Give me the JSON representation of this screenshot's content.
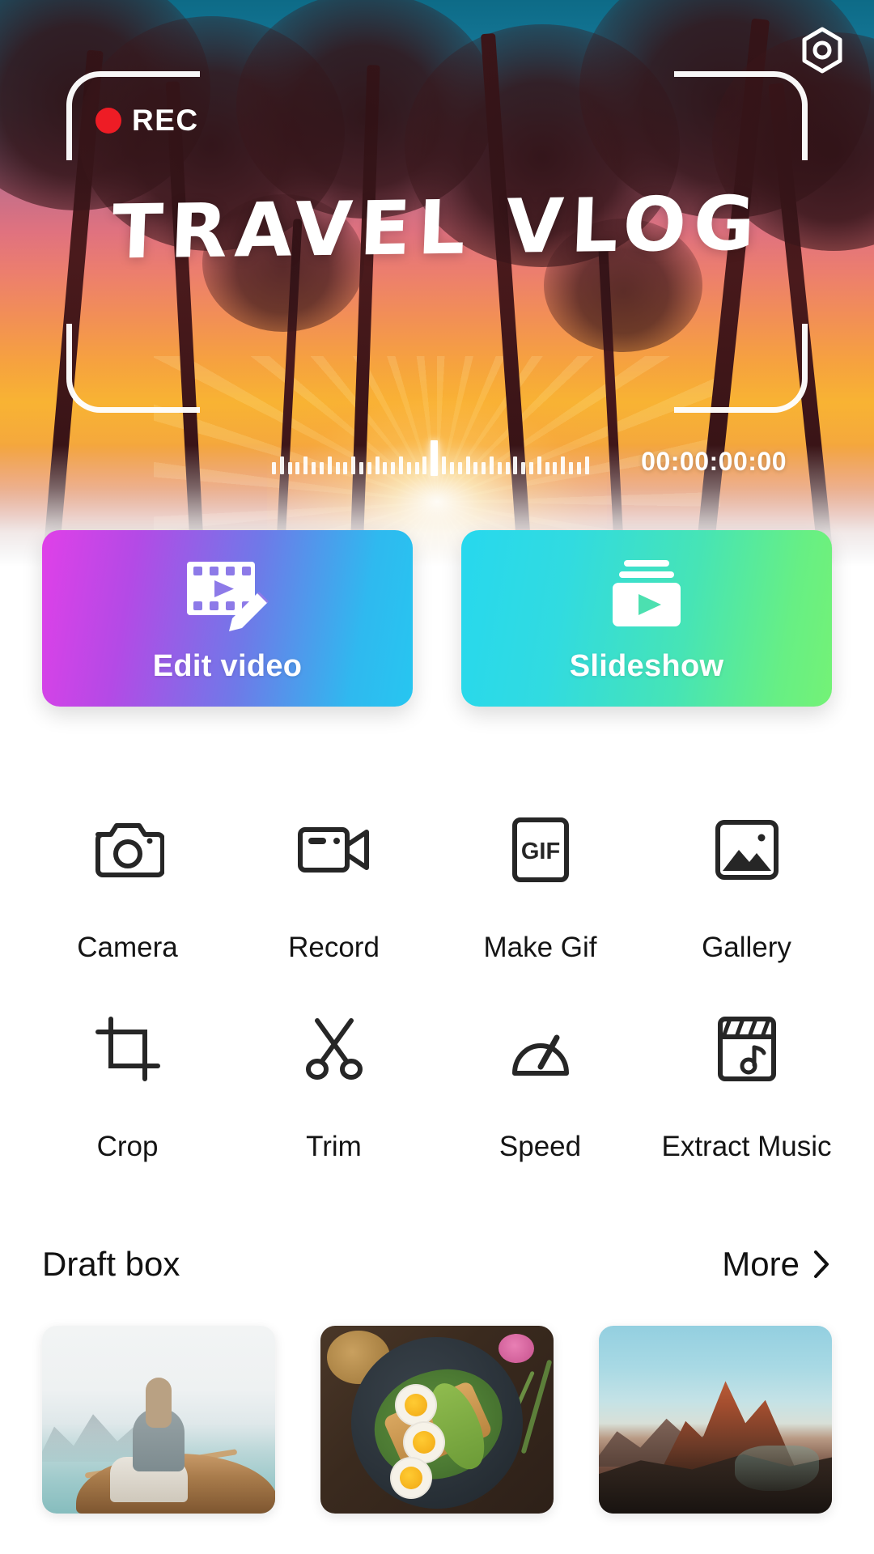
{
  "hero": {
    "rec_label": "REC",
    "title": "TRAVEL VLOG",
    "timecode": "00:00:00:00",
    "settings_icon": "hexagon-settings-icon",
    "rec_dot_color": "#ee1c25"
  },
  "primary_cards": [
    {
      "label": "Edit video",
      "icon": "film-strip-pencil-icon",
      "gradient_from": "#e040e8",
      "gradient_to": "#27c6f0"
    },
    {
      "label": "Slideshow",
      "icon": "stacked-slides-play-icon",
      "gradient_from": "#27d8ee",
      "gradient_to": "#74f276"
    }
  ],
  "tools": [
    {
      "label": "Camera",
      "icon": "camera-icon"
    },
    {
      "label": "Record",
      "icon": "video-camera-icon"
    },
    {
      "label": "Make Gif",
      "icon": "gif-icon"
    },
    {
      "label": "Gallery",
      "icon": "image-icon"
    },
    {
      "label": "Crop",
      "icon": "crop-icon"
    },
    {
      "label": "Trim",
      "icon": "scissors-icon"
    },
    {
      "label": "Speed",
      "icon": "speedometer-icon"
    },
    {
      "label": "Extract Music",
      "icon": "clapperboard-music-icon"
    }
  ],
  "draft_box": {
    "title": "Draft box",
    "more_label": "More",
    "more_icon": "chevron-right-icon",
    "items": [
      {
        "name": "lake-boat-draft"
      },
      {
        "name": "food-plate-draft"
      },
      {
        "name": "mountain-draft"
      }
    ]
  }
}
